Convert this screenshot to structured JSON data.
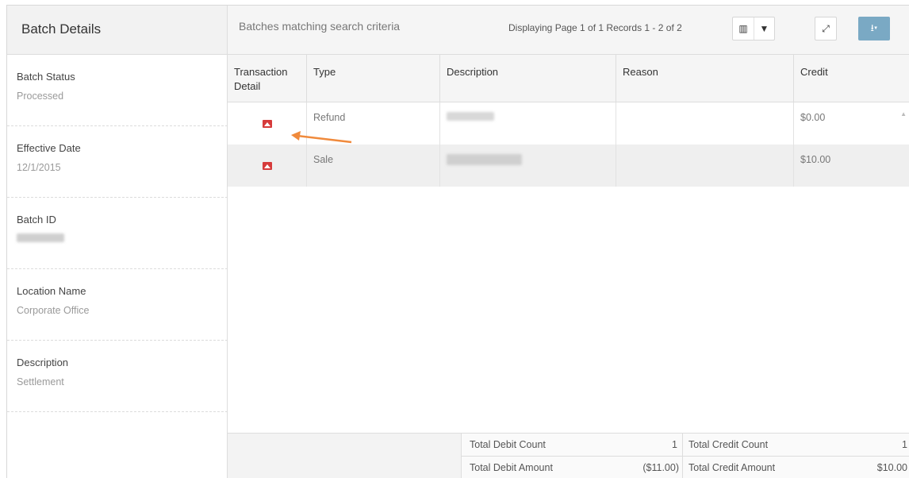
{
  "left_panel": {
    "title": "Batch Details",
    "fields": [
      {
        "label": "Batch Status",
        "value": "Processed"
      },
      {
        "label": "Effective Date",
        "value": "12/1/2015"
      },
      {
        "label": "Batch ID",
        "value": ""
      },
      {
        "label": "Location Name",
        "value": "Corporate Office"
      },
      {
        "label": "Description",
        "value": "Settlement"
      }
    ]
  },
  "header": {
    "subtitle": "Batches matching search criteria",
    "pager": "Displaying Page 1 of 1 Records 1 - 2 of 2",
    "toolbar": {
      "columns_icon": "▥",
      "filter_icon": "▼",
      "expand_icon": "⤢",
      "export_label": "⭳▾"
    }
  },
  "grid": {
    "columns": [
      "Transaction Detail",
      "Type",
      "Description",
      "Reason",
      "Credit"
    ],
    "rows": [
      {
        "type": "Refund",
        "description": "",
        "reason": "",
        "credit": "$0.00"
      },
      {
        "type": "Sale",
        "description": "",
        "reason": "",
        "credit": "$10.00"
      }
    ],
    "scroll_up_glyph": "▲"
  },
  "totals": {
    "total_debit_count_label": "Total Debit Count",
    "total_debit_count": "1",
    "total_credit_count_label": "Total Credit Count",
    "total_credit_count": "1",
    "total_debit_amount_label": "Total Debit Amount",
    "total_debit_amount": "($11.00)",
    "total_credit_amount_label": "Total Credit Amount",
    "total_credit_amount": "$10.00"
  },
  "colors": {
    "accent": "#7aa9c4",
    "detail_icon": "#d63b3b",
    "annotation_arrow": "#f08a3c"
  }
}
